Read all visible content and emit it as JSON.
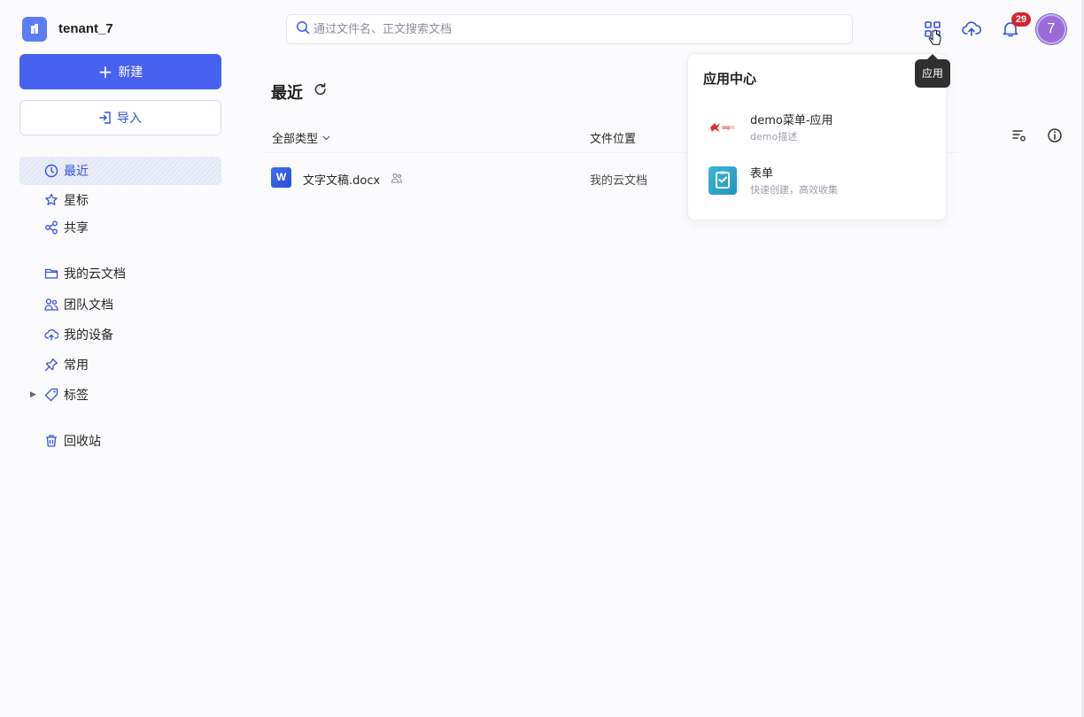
{
  "header": {
    "tenant": "tenant_7",
    "search_placeholder": "通过文件名、正文搜索文档",
    "notification_count": "29",
    "avatar_text": "7"
  },
  "sidebar": {
    "new_label": "新建",
    "import_label": "导入",
    "items": [
      {
        "label": "最近",
        "icon": "clock-icon",
        "active": true
      },
      {
        "label": "星标",
        "icon": "star-icon"
      },
      {
        "label": "共享",
        "icon": "share-icon"
      },
      {
        "label": "我的云文档",
        "icon": "folder-icon"
      },
      {
        "label": "团队文档",
        "icon": "team-icon"
      },
      {
        "label": "我的设备",
        "icon": "cloud-device-icon"
      },
      {
        "label": "常用",
        "icon": "pin-icon"
      },
      {
        "label": "标签",
        "icon": "tag-icon"
      },
      {
        "label": "回收站",
        "icon": "trash-icon"
      }
    ]
  },
  "main": {
    "title": "最近",
    "filter_label": "全部类型",
    "location_header": "文件位置",
    "files": [
      {
        "name": "文字文稿.docx",
        "icon_text": "W",
        "location": "我的云文档"
      }
    ]
  },
  "apps_popover": {
    "title": "应用中心",
    "items": [
      {
        "name": "demo菜单-应用",
        "desc": "demo描述",
        "icon": "demo-app-icon"
      },
      {
        "name": "表单",
        "desc": "快速创建，高效收集",
        "icon": "form-icon"
      }
    ]
  },
  "tooltip": "应用",
  "colors": {
    "accent": "#4762f0",
    "badge": "#d9232e",
    "avatar": "#9b6cd8"
  }
}
